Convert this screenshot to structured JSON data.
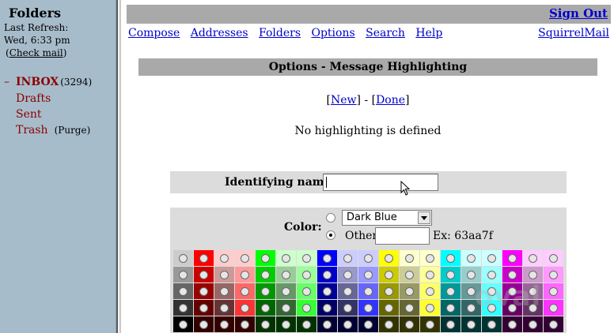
{
  "left_frame": {
    "title": "Folders",
    "last_refresh_label": "Last Refresh:",
    "last_refresh_value": "Wed, 6:33 pm",
    "check_mail_open": "(",
    "check_mail": "Check mail",
    "check_mail_close": ")",
    "inbox_marker": "–",
    "folders": [
      {
        "name": "INBOX",
        "count": "(3294)"
      },
      {
        "name": "Drafts"
      },
      {
        "name": "Sent"
      },
      {
        "name": "Trash",
        "action": "(Purge)"
      }
    ]
  },
  "header": {
    "sign_out": "Sign Out",
    "nav": [
      "Compose",
      "Addresses",
      "Folders",
      "Options",
      "Search",
      "Help"
    ],
    "brand_link": "SquirrelMail"
  },
  "page": {
    "title": "Options - Message Highlighting",
    "new_label": "New",
    "done_label": "Done",
    "empty_message": "No highlighting is defined"
  },
  "form": {
    "identifying_name_label": "Identifying name:",
    "identifying_name_value": "",
    "color_label": "Color:",
    "color_select_value": "Dark Blue",
    "color_mode": "other",
    "other_label": "Other:",
    "other_value": "",
    "example_text": "Ex: 63aa7f"
  },
  "palette": {
    "columns": [
      [
        "#cccccc",
        "#999999",
        "#666666",
        "#333333",
        "#000000"
      ],
      [
        "#ff0000",
        "#cc0000",
        "#990000",
        "#660000",
        "#330000"
      ],
      [
        "#ffcccc",
        "#cc9999",
        "#996666",
        "#663333",
        "#330000"
      ],
      [
        "#ffcccc",
        "#ff9999",
        "#ff6666",
        "#ff3333",
        "#330000"
      ],
      [
        "#00ff00",
        "#00cc00",
        "#009900",
        "#006600",
        "#003300"
      ],
      [
        "#ccffcc",
        "#99cc99",
        "#669966",
        "#336633",
        "#003300"
      ],
      [
        "#ccffcc",
        "#99ff99",
        "#66ff66",
        "#33ff33",
        "#003300"
      ],
      [
        "#0000ff",
        "#0000cc",
        "#000099",
        "#000066",
        "#000033"
      ],
      [
        "#ccccff",
        "#9999cc",
        "#666699",
        "#333366",
        "#000033"
      ],
      [
        "#ccccff",
        "#9999ff",
        "#6666ff",
        "#3333ff",
        "#000033"
      ],
      [
        "#ffff00",
        "#cccc00",
        "#999900",
        "#666600",
        "#333300"
      ],
      [
        "#ffffcc",
        "#cccc99",
        "#999966",
        "#666633",
        "#333300"
      ],
      [
        "#ffffcc",
        "#ffff99",
        "#ffff66",
        "#ffff33",
        "#333300"
      ],
      [
        "#00ffff",
        "#00cccc",
        "#009999",
        "#006666",
        "#003333"
      ],
      [
        "#ccffff",
        "#99cccc",
        "#669999",
        "#336666",
        "#003333"
      ],
      [
        "#ccffff",
        "#99ffff",
        "#66ffff",
        "#33ffff",
        "#003333"
      ],
      [
        "#ff00ff",
        "#cc00cc",
        "#990099",
        "#660066",
        "#330033"
      ],
      [
        "#ffccff",
        "#cc99cc",
        "#996699",
        "#663366",
        "#330033"
      ],
      [
        "#ffccff",
        "#ff99ff",
        "#ff66ff",
        "#ff33ff",
        "#330033"
      ]
    ]
  },
  "colors": {
    "left_frame_bg": "#a7bccb",
    "bar_bg": "#a9a9a9",
    "panel_bg": "#dcdcdc",
    "link": "#0000cc",
    "folder": "#8a0000"
  },
  "icons": {
    "select_arrow": "chevron-down-icon",
    "mouse_cursor": "arrow-cursor-icon"
  }
}
